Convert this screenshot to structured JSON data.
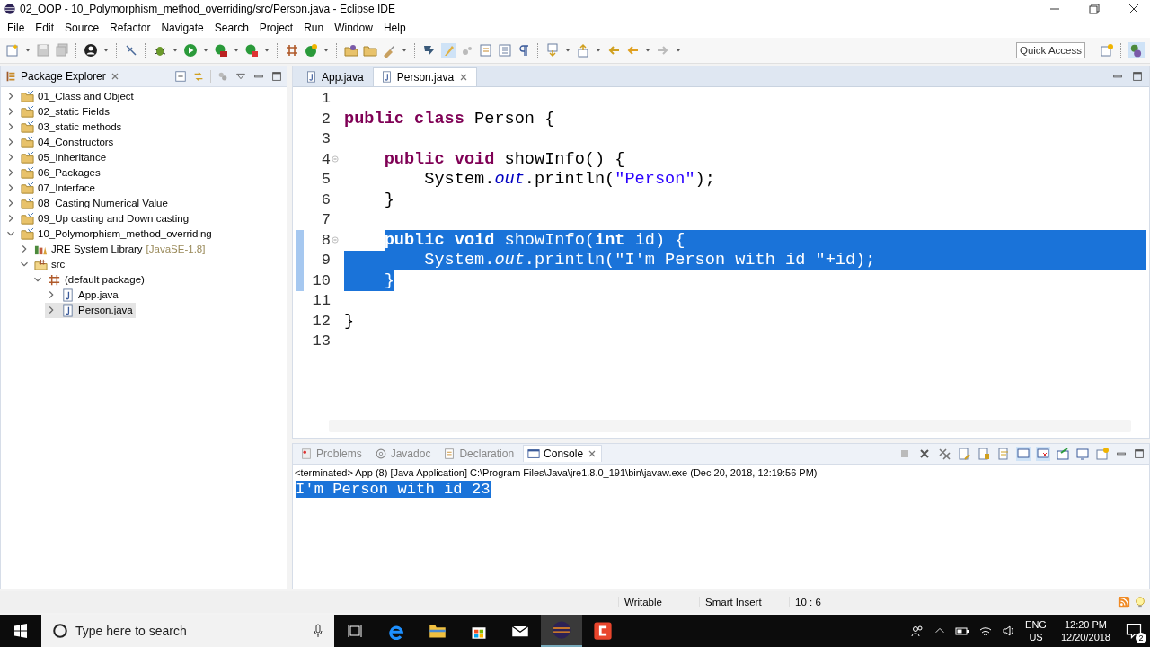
{
  "window": {
    "title": "02_OOP - 10_Polymorphism_method_overriding/src/Person.java - Eclipse IDE"
  },
  "menu": [
    "File",
    "Edit",
    "Source",
    "Refactor",
    "Navigate",
    "Search",
    "Project",
    "Run",
    "Window",
    "Help"
  ],
  "quick_access": "Quick Access",
  "package_explorer": {
    "title": "Package Explorer",
    "items": [
      {
        "label": "01_Class and Object",
        "kind": "project",
        "expanded": false,
        "selected": false
      },
      {
        "label": "02_static Fields",
        "kind": "project",
        "expanded": false,
        "selected": false
      },
      {
        "label": "03_static methods",
        "kind": "project",
        "expanded": false,
        "selected": false
      },
      {
        "label": "04_Constructors",
        "kind": "project",
        "expanded": false,
        "selected": false
      },
      {
        "label": "05_Inheritance",
        "kind": "project",
        "expanded": false,
        "selected": false
      },
      {
        "label": "06_Packages",
        "kind": "project",
        "expanded": false,
        "selected": false
      },
      {
        "label": "07_Interface",
        "kind": "project",
        "expanded": false,
        "selected": false
      },
      {
        "label": "08_Casting Numerical Value",
        "kind": "project",
        "expanded": false,
        "selected": false
      },
      {
        "label": "09_Up casting and Down casting",
        "kind": "project",
        "expanded": false,
        "selected": false
      },
      {
        "label": "10_Polymorphism_method_overriding",
        "kind": "project",
        "expanded": true,
        "selected": false,
        "children": [
          {
            "label": "JRE System Library",
            "qualifier": "[JavaSE-1.8]",
            "kind": "library",
            "expanded": false,
            "selected": false
          },
          {
            "label": "src",
            "kind": "source",
            "expanded": true,
            "selected": false,
            "children": [
              {
                "label": "(default package)",
                "kind": "package",
                "expanded": true,
                "selected": false,
                "children": [
                  {
                    "label": "App.java",
                    "kind": "file",
                    "expanded": false,
                    "selected": false
                  },
                  {
                    "label": "Person.java",
                    "kind": "file",
                    "expanded": false,
                    "selected": true
                  }
                ]
              }
            ]
          }
        ]
      }
    ]
  },
  "editor": {
    "tabs": [
      {
        "label": "App.java",
        "selected": false
      },
      {
        "label": "Person.java",
        "selected": true
      }
    ],
    "lines": [
      {
        "number": "1",
        "fold": false,
        "selected": false
      },
      {
        "number": "2",
        "fold": false,
        "selected": false,
        "segments": [
          {
            "kind": "keyword",
            "text": "public class"
          },
          {
            "kind": "plain",
            "text": " Person {"
          }
        ]
      },
      {
        "number": "3",
        "fold": false,
        "selected": false
      },
      {
        "number": "4",
        "fold": true,
        "selected": false,
        "segments": [
          {
            "kind": "keyword",
            "text": "    public void"
          },
          {
            "kind": "plain",
            "text": " showInfo() {"
          }
        ]
      },
      {
        "number": "5",
        "fold": false,
        "selected": false,
        "segments": [
          {
            "kind": "plain",
            "text": "        System."
          },
          {
            "kind": "field",
            "text": "out"
          },
          {
            "kind": "plain",
            "text": ".println("
          },
          {
            "kind": "string",
            "text": "\"Person\""
          },
          {
            "kind": "plain",
            "text": ");"
          }
        ]
      },
      {
        "number": "6",
        "fold": false,
        "selected": false,
        "segments": [
          {
            "kind": "plain",
            "text": "    }"
          }
        ]
      },
      {
        "number": "7",
        "fold": false,
        "selected": false
      },
      {
        "number": "8",
        "fold": true,
        "selected": true,
        "segments": [
          {
            "kind": "keyword",
            "text": "    public void"
          },
          {
            "kind": "plain",
            "text": " showInfo("
          },
          {
            "kind": "keyword",
            "text": "int"
          },
          {
            "kind": "plain",
            "text": " id) {"
          }
        ]
      },
      {
        "number": "9",
        "fold": false,
        "selected": true,
        "segments": [
          {
            "kind": "plain",
            "text": "        System."
          },
          {
            "kind": "field",
            "text": "out"
          },
          {
            "kind": "plain",
            "text": ".println("
          },
          {
            "kind": "string",
            "text": "\"I'm Person with id \""
          },
          {
            "kind": "plain",
            "text": "+id);"
          }
        ]
      },
      {
        "number": "10",
        "fold": false,
        "selected": true,
        "segments": [
          {
            "kind": "plain",
            "text": "    }"
          }
        ]
      },
      {
        "number": "11",
        "fold": false,
        "selected": false
      },
      {
        "number": "12",
        "fold": false,
        "selected": false,
        "segments": [
          {
            "kind": "plain",
            "text": "}"
          }
        ]
      },
      {
        "number": "13",
        "fold": false,
        "selected": false
      }
    ]
  },
  "console": {
    "tabs": [
      {
        "label": "Problems",
        "kind": "problems",
        "selected": false
      },
      {
        "label": "Javadoc",
        "kind": "javadoc",
        "selected": false
      },
      {
        "label": "Declaration",
        "kind": "declaration",
        "selected": false
      },
      {
        "label": "Console",
        "kind": "console",
        "selected": true
      }
    ],
    "status": "<terminated> App (8) [Java Application] C:\\Program Files\\Java\\jre1.8.0_191\\bin\\javaw.exe (Dec 20, 2018, 12:19:56 PM)",
    "output": [
      {
        "text": "I'm Person with id 23",
        "selected": true
      }
    ]
  },
  "status_bar": [
    "Writable",
    "Smart Insert",
    "10 : 6"
  ],
  "taskbar": {
    "search_placeholder": "Type here to search",
    "language": "ENG",
    "region": "US",
    "time": "12:20 PM",
    "date": "12/20/2018",
    "notifications": "2"
  }
}
